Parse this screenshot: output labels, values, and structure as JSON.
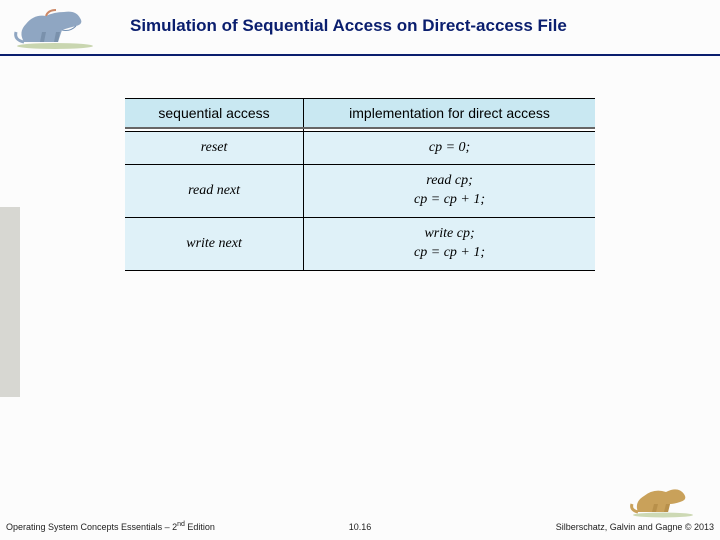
{
  "header": {
    "title": "Simulation of Sequential Access on Direct-access File"
  },
  "table": {
    "headers": [
      "sequential access",
      "implementation for direct access"
    ],
    "rows": [
      {
        "op": "reset",
        "impl": "cp = 0;"
      },
      {
        "op": "read next",
        "impl": "read cp;\ncp = cp + 1;"
      },
      {
        "op": "write next",
        "impl": "write cp;\ncp = cp + 1;"
      }
    ]
  },
  "footer": {
    "left_prefix": "Operating System Concepts Essentials – 2",
    "left_suffix": " Edition",
    "left_sup": "nd",
    "center": "10.16",
    "right": "Silberschatz, Galvin and Gagne © 2013"
  },
  "icons": {
    "dino_left": "dinosaur-icon",
    "dino_right": "dinosaur-icon"
  }
}
